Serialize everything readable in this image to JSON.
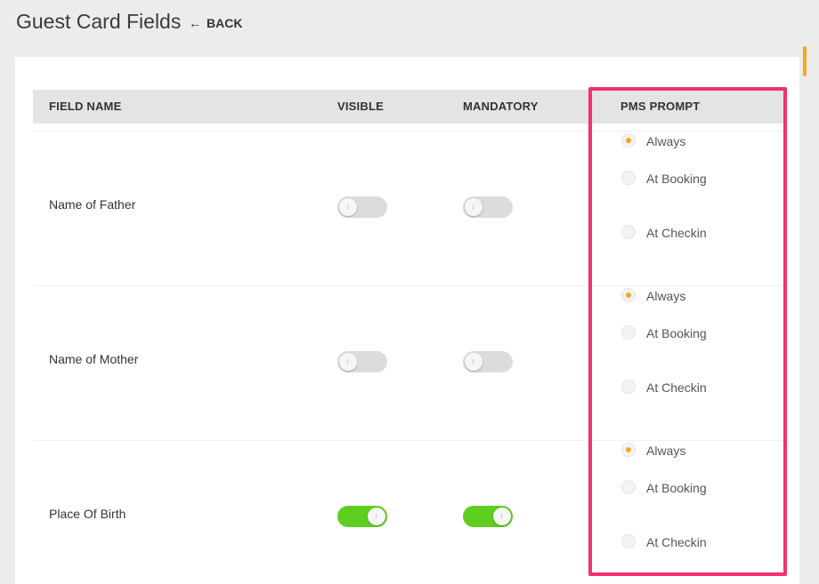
{
  "header": {
    "title": "Guest Card Fields",
    "back_label": "BACK",
    "back_icon": "←"
  },
  "table": {
    "columns": {
      "field_name": "FIELD NAME",
      "visible": "VISIBLE",
      "mandatory": "MANDATORY",
      "pms_prompt": "PMS PROMPT"
    },
    "rows": [
      {
        "name": "Name of Father",
        "visible": false,
        "mandatory": false,
        "prompt": [
          "Always",
          "At Booking",
          "At Checkin"
        ],
        "selected": "Always"
      },
      {
        "name": "Name of Mother",
        "visible": false,
        "mandatory": false,
        "prompt": [
          "Always",
          "At Booking",
          "At Checkin"
        ],
        "selected": "Always"
      },
      {
        "name": "Place Of Birth",
        "visible": true,
        "mandatory": true,
        "prompt": [
          "Always",
          "At Booking",
          "At Checkin"
        ],
        "selected": "Always"
      }
    ]
  },
  "colors": {
    "toggle_on": "#5ecf1e",
    "radio_selected": "#f5a623",
    "highlight": "#f2316f"
  }
}
